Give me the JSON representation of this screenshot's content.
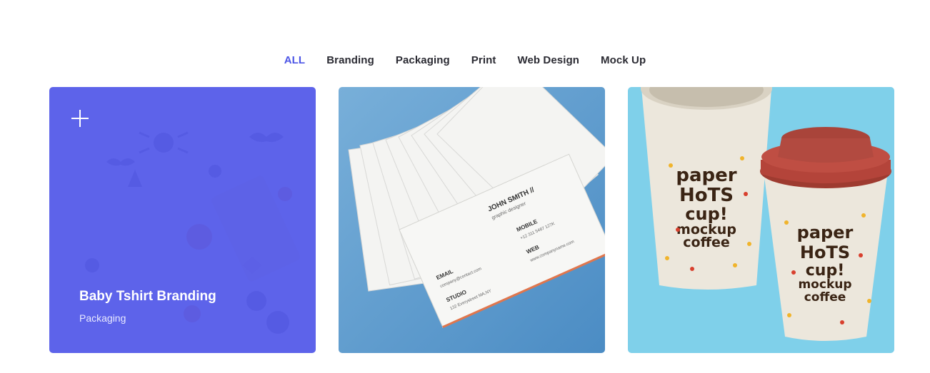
{
  "filters": [
    {
      "label": "ALL",
      "active": true
    },
    {
      "label": "Branding"
    },
    {
      "label": "Packaging"
    },
    {
      "label": "Print"
    },
    {
      "label": "Web Design"
    },
    {
      "label": "Mock Up"
    }
  ],
  "portfolio": {
    "items": [
      {
        "title": "Baby Tshirt Branding",
        "category": "Packaging",
        "icon": "plus-icon"
      },
      {
        "card_text": {
          "name": "JOHN SMITH //",
          "role": "graphic designer",
          "mobile_label": "MOBILE",
          "mobile": "+12 311 5467 127K",
          "email_label": "EMAIL",
          "email": "company@contact.com",
          "web_label": "WEB",
          "web": "www.companyname.com",
          "studio_label": "STUDIO",
          "studio": "132 Everystreet MA,NY"
        }
      },
      {
        "cup_text": {
          "line1": "paper",
          "line2": "HoTS",
          "line3": "cup!",
          "line4": "mockup",
          "line5": "coffee"
        }
      }
    ]
  },
  "colors": {
    "accent": "#4c55e6",
    "overlay": "#5258e8"
  }
}
